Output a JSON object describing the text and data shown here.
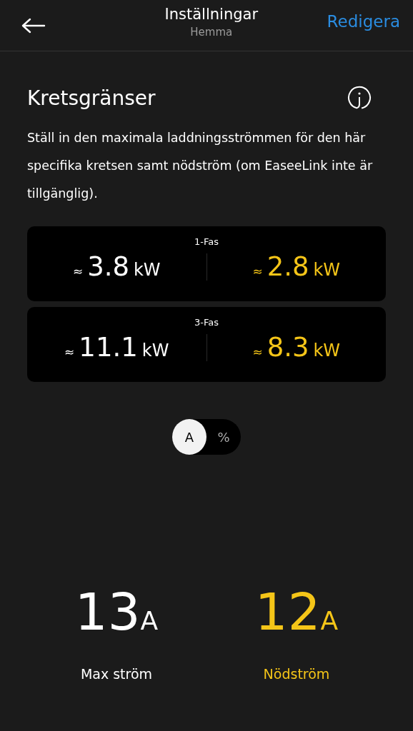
{
  "header": {
    "title": "Inställningar",
    "subtitle": "Hemma",
    "action": "Redigera"
  },
  "section": {
    "title": "Kretsgränser",
    "description": "Ställ in den maximala laddningsströmmen för den här specifika kretsen samt nödström (om EaseeLink inte är tillgänglig)."
  },
  "phases": [
    {
      "label": "1-Fas",
      "values": [
        {
          "kind": "max",
          "approx": "≈",
          "number": "3.8",
          "unit": "kW"
        },
        {
          "kind": "emergency",
          "approx": "≈",
          "number": "2.8",
          "unit": "kW"
        }
      ]
    },
    {
      "label": "3-Fas",
      "values": [
        {
          "kind": "max",
          "approx": "≈",
          "number": "11.1",
          "unit": "kW"
        },
        {
          "kind": "emergency",
          "approx": "≈",
          "number": "8.3",
          "unit": "kW"
        }
      ]
    }
  ],
  "unit_toggle": [
    {
      "label": "A",
      "selected": true
    },
    {
      "label": "%",
      "selected": false
    }
  ],
  "limits": [
    {
      "kind": "max",
      "number": "13",
      "unit": "A",
      "label": "Max ström"
    },
    {
      "kind": "emergency",
      "number": "12",
      "unit": "A",
      "label": "Nödström"
    }
  ]
}
